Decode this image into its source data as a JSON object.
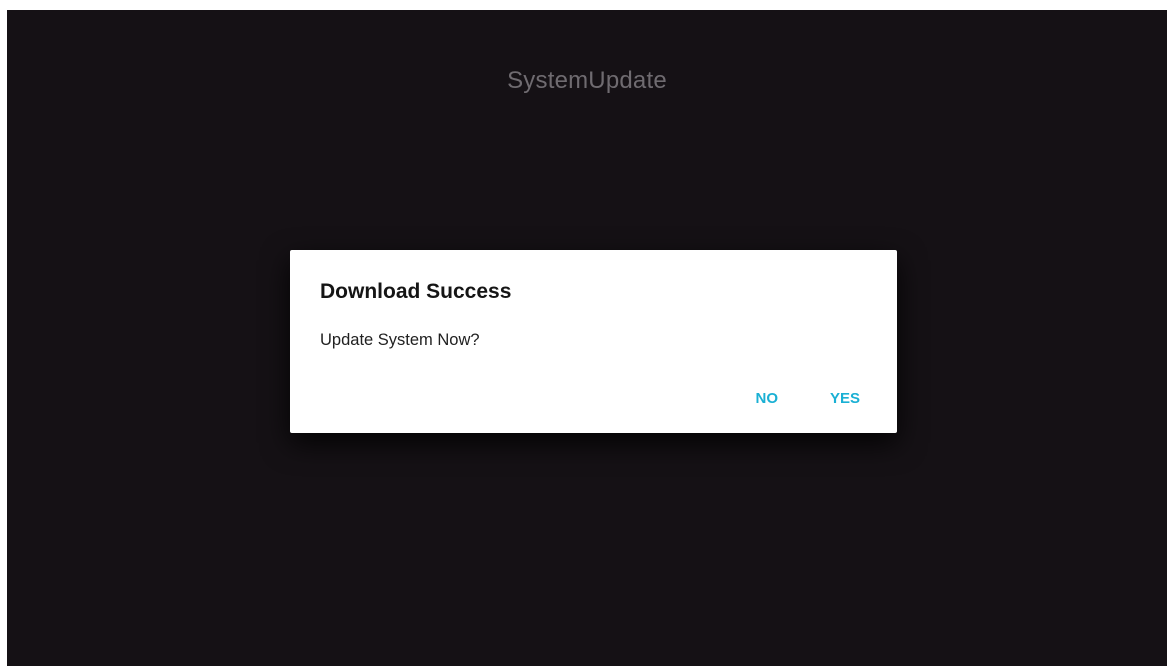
{
  "app": {
    "title": "SystemUpdate"
  },
  "dialog": {
    "title": "Download Success",
    "message": "Update System Now?",
    "buttons": {
      "negative": "NO",
      "positive": "YES"
    }
  },
  "colors": {
    "background": "#151115",
    "dialog_background": "#ffffff",
    "accent": "#1ab0d4",
    "title_text": "#6f6b70"
  }
}
